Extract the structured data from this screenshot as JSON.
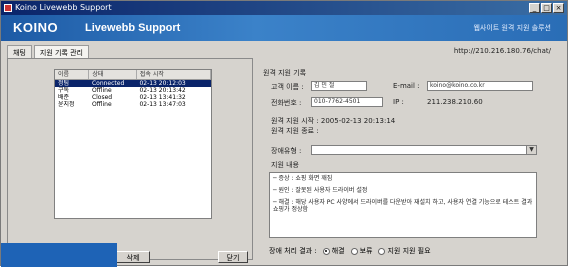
{
  "window": {
    "title": "Koino Livewebb Support",
    "min": "_",
    "max": "□",
    "close": "×"
  },
  "banner": {
    "logo": "KOINO",
    "title": "Livewebb Support",
    "right_text": "웹사이트 원격 지원 솔루션"
  },
  "tabs": [
    {
      "label": "채팅"
    },
    {
      "label": "지원 기록 관리"
    }
  ],
  "url": "http://210.216.180.76/chat/",
  "list": {
    "headers": [
      "이름",
      "상태",
      "접속 시작"
    ],
    "rows": [
      {
        "name": "정팀",
        "status": "Connected",
        "time": "02-13 20:12:03",
        "selected": true
      },
      {
        "name": "구독",
        "status": "Offline",
        "time": "02-13 20:13:42",
        "selected": false
      },
      {
        "name": "배준",
        "status": "Closed",
        "time": "02-13 13:41:32",
        "selected": false
      },
      {
        "name": "윤지정",
        "status": "Offline",
        "time": "02-13 13:47:03",
        "selected": false
      }
    ]
  },
  "left_buttons": {
    "delete": "삭제",
    "close": "닫기"
  },
  "right": {
    "section_title": "원격 지원 기록",
    "customer_label": "고객 이름 :",
    "customer_value": "김 민 철",
    "email_label": "E-mail :",
    "email_value": "koino@koino.co.kr",
    "phone_label": "전화번호 :",
    "phone_value": "010-7762-4501",
    "ip_label": "IP :",
    "ip_value": "211.238.210.60",
    "start_label": "원격 지원 시작 : 2005-02-13 20:13:14",
    "end_label": "원격 지원 종료 :",
    "type_label": "장애유형 :",
    "type_value": "",
    "content_label": "지원 내용",
    "notes": [
      "─ 증상 : 쇼핑 화면 깨짐",
      "─ 원인 : 잘못된 사용자 드라이버 설정",
      "─ 해결 : 해당 사용자 PC 사양에서 드라이버를 다운받아 재설치 하고, 사용자 연결 기능으로 테스트 결과 쇼핑가 정상함"
    ],
    "result_label": "장애 처리 결과 :",
    "radio_options": [
      {
        "label": "해결",
        "checked": true
      },
      {
        "label": "보류",
        "checked": false
      },
      {
        "label": "지원 지원 필요",
        "checked": false
      }
    ]
  }
}
